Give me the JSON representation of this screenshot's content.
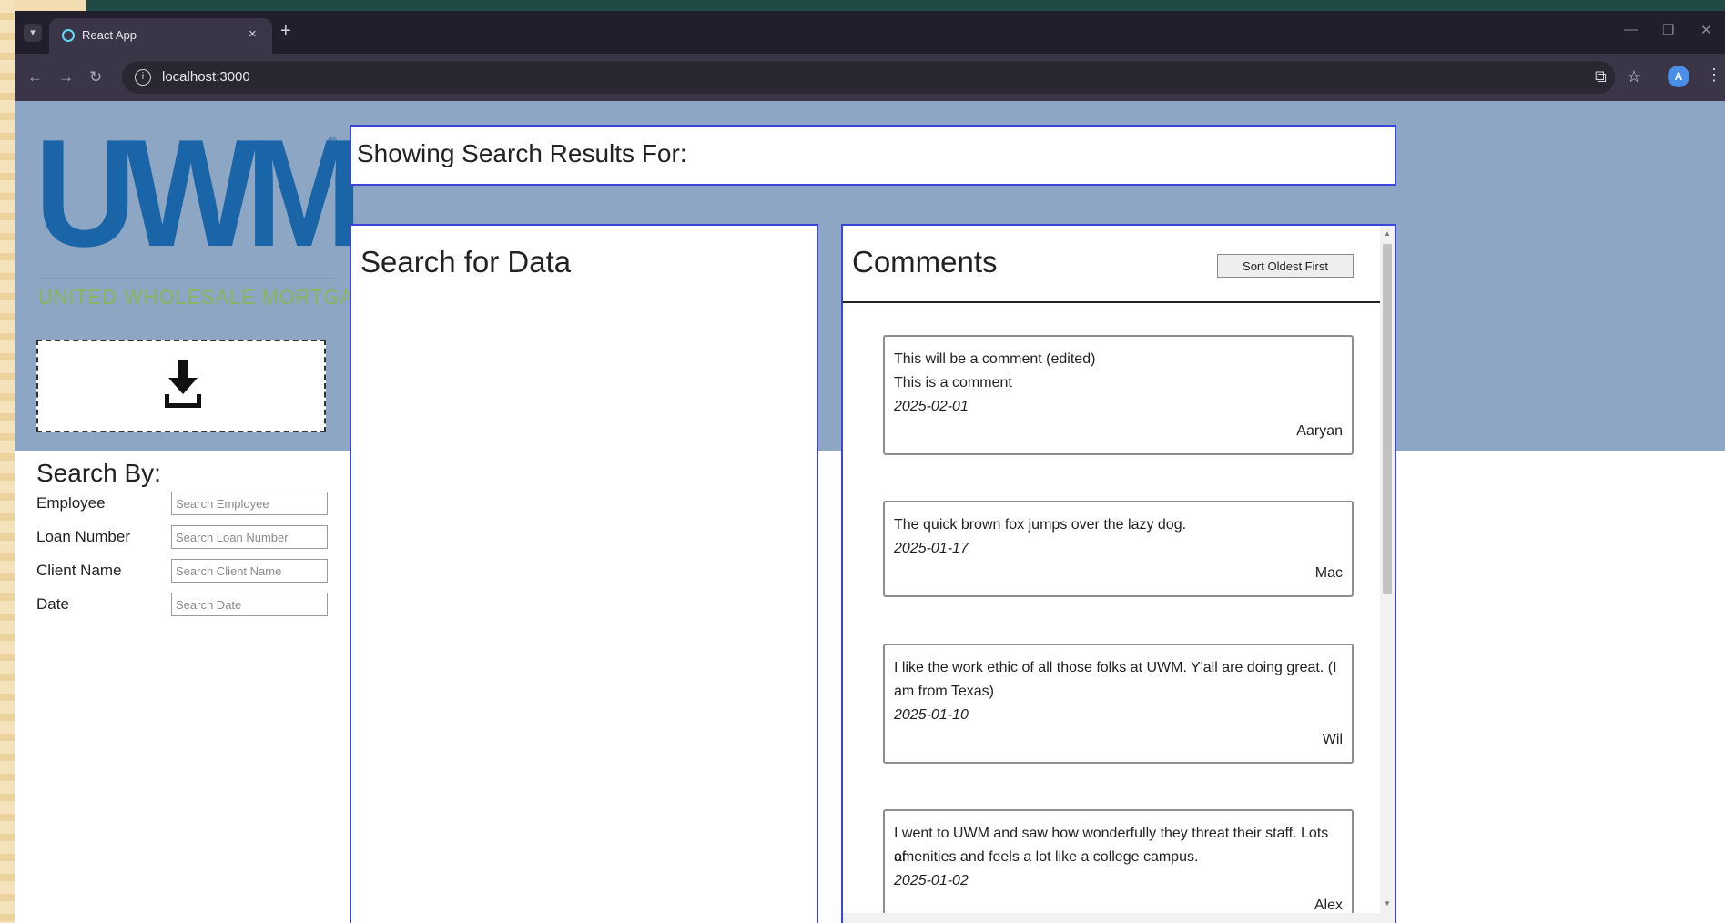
{
  "browser": {
    "tab_title": "React App",
    "tab_close": "×",
    "new_tab": "+",
    "url": "localhost:3000",
    "profile_initial": "A"
  },
  "logo": {
    "main": "UWM",
    "registered": "®",
    "subtitle": "UNITED WHOLESALE MORTGAGE"
  },
  "search": {
    "heading": "Search By:",
    "filters": [
      {
        "label": "Employee",
        "placeholder": "Search Employee",
        "value": ""
      },
      {
        "label": "Loan Number",
        "placeholder": "Search Loan Number",
        "value": ""
      },
      {
        "label": "Client Name",
        "placeholder": "Search Client Name",
        "value": ""
      },
      {
        "label": "Date",
        "placeholder": "Search Date",
        "value": ""
      }
    ]
  },
  "results": {
    "label": "Showing Search Results For:"
  },
  "data_panel": {
    "title": "Search for Data"
  },
  "comments": {
    "title": "Comments",
    "sort_label": "Sort Oldest First",
    "items": [
      {
        "lines": [
          "This will be a comment (edited)",
          "This is a comment"
        ],
        "date": "2025-02-01",
        "author": "Aaryan"
      },
      {
        "lines": [
          "The quick brown fox jumps over the lazy dog."
        ],
        "date": "2025-01-17",
        "author": "Mac"
      },
      {
        "lines": [
          "I like the work ethic of all those folks at UWM. Y'all are doing great. (I",
          "am from Texas)"
        ],
        "date": "2025-01-10",
        "author": "Wil"
      },
      {
        "lines": [
          "I went to UWM and saw how wonderfully they threat their staff. Lots of",
          "amenities and feels a lot like a college campus."
        ],
        "date": "2025-01-02",
        "author": "Alex"
      }
    ]
  },
  "colors": {
    "header_bg": "#8ca6c4",
    "panel_border": "#3a46d8",
    "logo_blue": "#1a64a8",
    "logo_green": "#8bb55b"
  }
}
